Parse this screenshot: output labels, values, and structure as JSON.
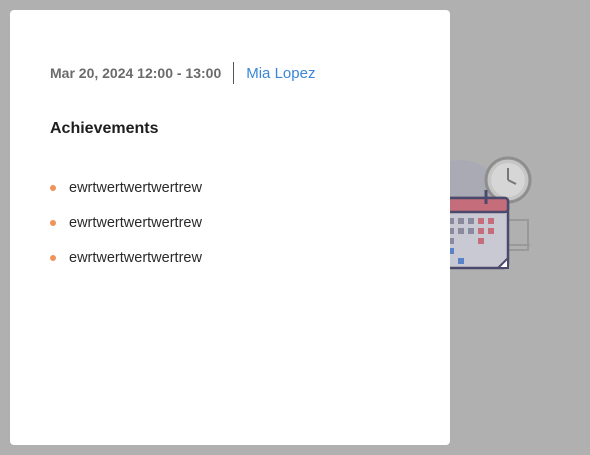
{
  "meta": {
    "datetime": "Mar 20, 2024 12:00 - 13:00",
    "user_name": "Mia Lopez"
  },
  "section": {
    "title": "Achievements"
  },
  "achievements": [
    {
      "text": "ewrtwertwertwertrew"
    },
    {
      "text": "ewrtwertwertwertrew"
    },
    {
      "text": "ewrtwertwertwertrew"
    }
  ],
  "icons": {
    "bullet": "bullet-dot-icon",
    "illustration": "calendar-clock-illustration"
  },
  "colors": {
    "accent_link": "#3a86d8",
    "bullet": "#f0935a",
    "overlay": "#b0b0b0"
  }
}
